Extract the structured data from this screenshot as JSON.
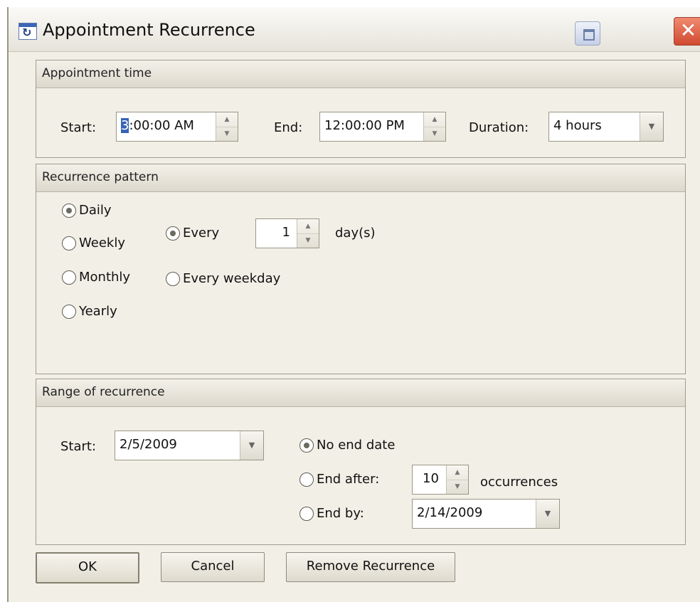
{
  "window": {
    "title": "Appointment Recurrence",
    "icon": "recurrence-icon",
    "controls": {
      "restore": "restore-icon",
      "close": "close-icon",
      "close_glyph": "✕"
    }
  },
  "appointment_time": {
    "header": "Appointment time",
    "start_label": "Start:",
    "start_value_selected": "3",
    "start_value_rest": ":00:00 AM",
    "end_label": "End:",
    "end_value": "12:00:00 PM",
    "duration_label": "Duration:",
    "duration_value": "4 hours"
  },
  "recurrence_pattern": {
    "header": "Recurrence pattern",
    "types": [
      {
        "label": "Daily",
        "checked": true
      },
      {
        "label": "Weekly",
        "checked": false
      },
      {
        "label": "Monthly",
        "checked": false
      },
      {
        "label": "Yearly",
        "checked": false
      }
    ],
    "daily_options": {
      "every_label": "Every",
      "every_checked": true,
      "every_value": "1",
      "unit": "day(s)",
      "weekday_label": "Every weekday",
      "weekday_checked": false
    }
  },
  "range": {
    "header": "Range of recurrence",
    "start_label": "Start:",
    "start_value": "2/5/2009",
    "no_end_label": "No end date",
    "no_end_checked": true,
    "end_after_label": "End after:",
    "end_after_value": "10",
    "occurrences_label": "occurrences",
    "end_by_label": "End by:",
    "end_by_value": "2/14/2009"
  },
  "buttons": {
    "ok": "OK",
    "cancel": "Cancel",
    "remove": "Remove Recurrence"
  }
}
